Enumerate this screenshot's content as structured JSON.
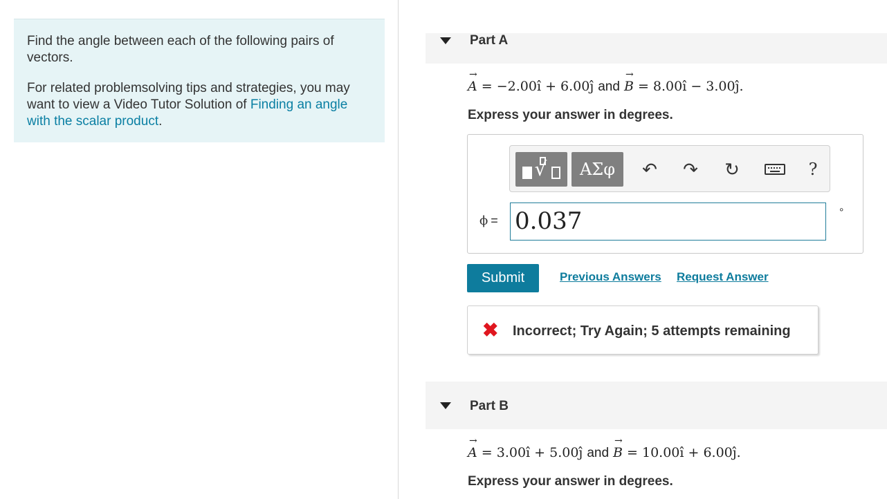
{
  "intro": {
    "paragraph1": "Find the angle between each of the following pairs of vectors.",
    "paragraph2_prefix": "For related problemsolving tips and strategies, you may want to view a Video Tutor Solution of ",
    "paragraph2_link": "Finding an angle with the scalar product",
    "paragraph2_suffix": "."
  },
  "partA": {
    "title": "Part A",
    "vecA": "A",
    "vecA_expr": " = −2.00î + 6.00ĵ",
    "and": "and",
    "vecB": "B",
    "vecB_expr": " = 8.00î − 3.00ĵ.",
    "instruction": "Express your answer in degrees.",
    "toolbar": {
      "greek_label": "ΑΣφ",
      "undo_glyph": "↶",
      "redo_glyph": "↷",
      "reset_glyph": "↻",
      "help_label": "?"
    },
    "variable": "ϕ",
    "equals": "=",
    "answer_value": "0.037",
    "unit": "°",
    "submit_label": "Submit",
    "previous_answers_label": "Previous Answers",
    "request_answer_label": "Request Answer",
    "feedback_icon": "✖",
    "feedback_text": "Incorrect; Try Again; 5 attempts remaining"
  },
  "partB": {
    "title": "Part B",
    "vecA": "A",
    "vecA_expr": " = 3.00î + 5.00ĵ",
    "and": "and",
    "vecB": "B",
    "vecB_expr": " = 10.00î + 6.00ĵ.",
    "instruction": "Express your answer in degrees."
  },
  "colors": {
    "accent": "#0e7c9d",
    "intro_background": "#e6f4f6",
    "error": "#e0161f"
  }
}
